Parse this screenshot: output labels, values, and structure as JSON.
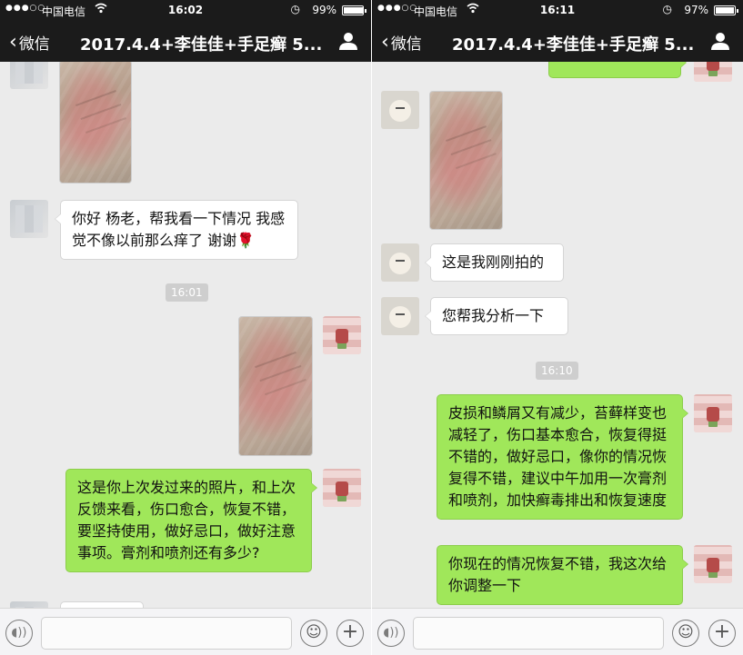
{
  "colors": {
    "nav_bg": "#1b1b1b",
    "chat_bg": "#ebebeb",
    "bubble_sent": "#a0e75a",
    "bubble_received": "#ffffff"
  },
  "left": {
    "status": {
      "carrier": "中国电信",
      "time": "16:02",
      "battery": "99%",
      "battery_level": 0.99
    },
    "nav": {
      "back": "微信",
      "title": "2017.4.4+李佳佳+手足癣 5..."
    },
    "messages": {
      "m1": "你好 杨老，帮我看一下情况 我感觉不像以前那么痒了 谢谢🌹",
      "ts1": "16:01",
      "m2": "这是你上次发过来的照片，和上次反馈来看，伤口愈合，恢复不错，要坚持使用，做好忌口，做好注意事项。膏剂和喷剂还有多少?"
    }
  },
  "right": {
    "status": {
      "carrier": "中国电信",
      "time": "16:11",
      "battery": "97%",
      "battery_level": 0.97
    },
    "nav": {
      "back": "微信",
      "title": "2017.4.4+李佳佳+手足癣 5..."
    },
    "messages": {
      "m1": "这是我刚刚拍的",
      "m2": "您帮我分析一下",
      "ts1": "16:10",
      "m3": "皮损和鳞屑又有减少，苔藓样变也减轻了，伤口基本愈合，恢复得挺不错的，做好忌口，像你的情况恢复得不错，建议中午加用一次膏剂和喷剂，加快癣毒排出和恢复速度",
      "m4": "你现在的情况恢复不错，我这次给你调整一下"
    }
  },
  "icons": {
    "voice": "voice-icon",
    "emoji": "emoji-icon",
    "plus": "plus-icon",
    "profile": "person-icon",
    "back": "chevron-left-icon"
  }
}
